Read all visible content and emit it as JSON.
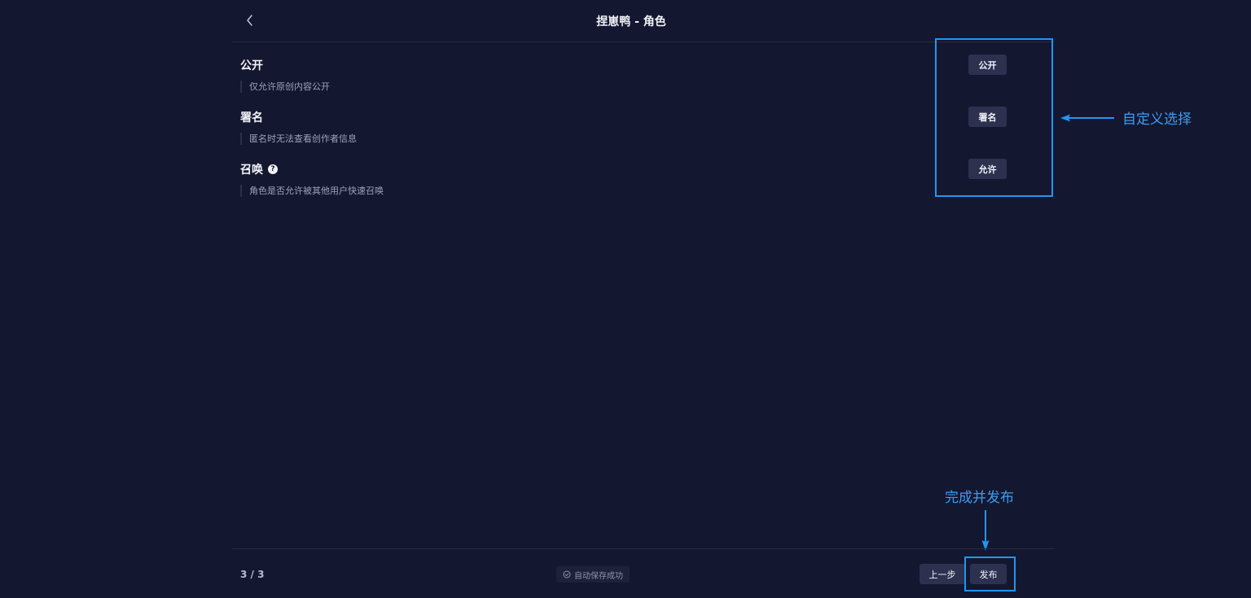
{
  "header": {
    "title": "捏崽鸭 - 角色",
    "back_icon": "chevron-left-icon"
  },
  "settings": [
    {
      "title": "公开",
      "desc": "仅允许原创内容公开",
      "value": "公开"
    },
    {
      "title": "署名",
      "desc": "匿名时无法查看创作者信息",
      "value": "署名"
    },
    {
      "title": "召唤",
      "desc": "角色是否允许被其他用户快速召唤",
      "value": "允许",
      "help_icon": "?"
    }
  ],
  "annotations": {
    "custom_select": "自定义选择",
    "publish_hint": "完成并发布"
  },
  "footer": {
    "step": "3 / 3",
    "autosave": "自动保存成功",
    "prev_label": "上一步",
    "publish_label": "发布"
  },
  "colors": {
    "background": "#141730",
    "button": "#2c3150",
    "annotation": "#2196f3",
    "text_primary": "#f2f3f8",
    "text_secondary": "#9ea3b8"
  }
}
